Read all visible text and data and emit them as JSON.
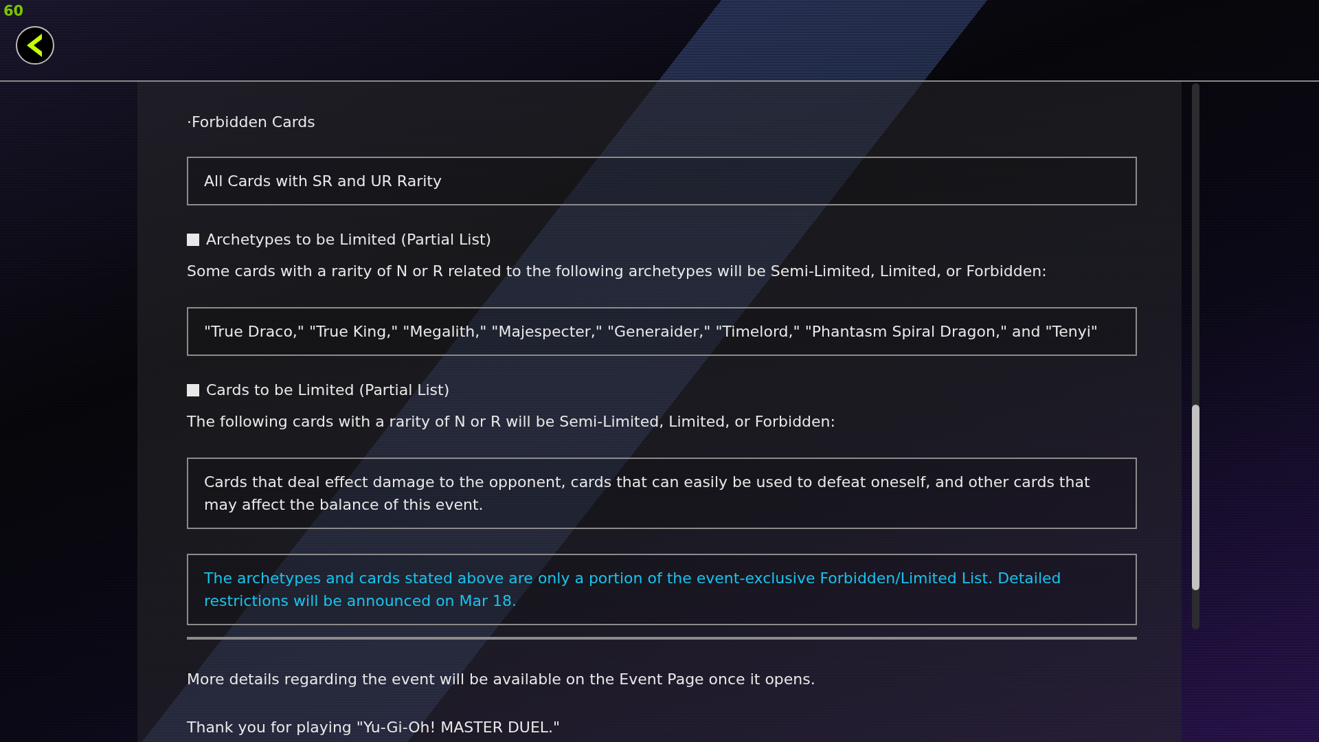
{
  "fps_counter": "60",
  "blocks": [
    {
      "kind": "heading",
      "text": "·Forbidden Cards"
    },
    {
      "kind": "box",
      "text": "All Cards with SR and UR Rarity"
    },
    {
      "kind": "subheading",
      "text": "Archetypes to be Limited (Partial List)"
    },
    {
      "kind": "paragraph",
      "text": "Some cards with a rarity of N or R related to the following archetypes will be Semi-Limited, Limited, or Forbidden:"
    },
    {
      "kind": "box",
      "text": "\"True Draco,\" \"True King,\" \"Megalith,\" \"Majespecter,\" \"Generaider,\" \"Timelord,\" \"Phantasm Spiral Dragon,\" and \"Tenyi\""
    },
    {
      "kind": "subheading",
      "text": "Cards to be Limited (Partial List)"
    },
    {
      "kind": "paragraph",
      "text": "The following cards with a rarity of N or R will be Semi-Limited, Limited, or Forbidden:"
    },
    {
      "kind": "box",
      "text": "Cards that deal effect damage to the opponent, cards that can easily be used to defeat oneself, and other cards that may affect the balance of this event."
    },
    {
      "kind": "notice",
      "text": "The archetypes and cards stated above are only a portion of the event-exclusive Forbidden/Limited List. Detailed restrictions will be announced on Mar 18."
    },
    {
      "kind": "paragraph",
      "text": "More details regarding the event will be available on the Event Page once it opens."
    },
    {
      "kind": "paragraph",
      "text": "Thank you for playing \"Yu-Gi-Oh! MASTER DUEL.\""
    }
  ]
}
